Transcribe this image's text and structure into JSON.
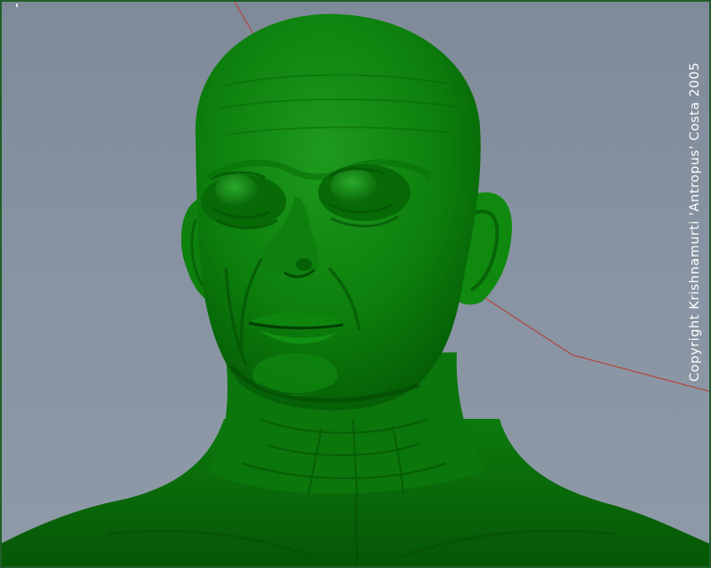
{
  "viewport": {
    "background_color": "#8591a0",
    "border_color": "#1f5f2a",
    "model_color": "#0f7d0f",
    "axis_line_color": "#b0463a"
  },
  "watermark": {
    "text": "Copyright Krishnamurti 'Antropus' Costa 2005",
    "color": "#ffffff"
  }
}
